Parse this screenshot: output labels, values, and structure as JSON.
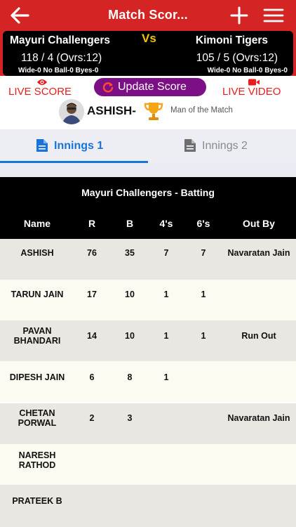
{
  "header": {
    "title": "Match Scor...",
    "back_icon": "back-arrow-icon",
    "add_icon": "plus-icon",
    "menu_icon": "hamburger-menu-icon",
    "bar_color": "#d42424"
  },
  "scoreboard": {
    "team_a": {
      "name": "Mayuri Challengers",
      "score": "118 / 4 (Ovrs:12)",
      "extras": "Wide-0 No Ball-0 Byes-0"
    },
    "vs_label": "Vs",
    "team_b": {
      "name": "Kimoni Tigers",
      "score": "105 / 5 (Ovrs:12)",
      "extras": "Wide-0 No Ball-0 Byes-0"
    },
    "vs_color": "#f5c400"
  },
  "actions": {
    "live_score_label": "LIVE SCORE",
    "update_score_label": "Update Score",
    "live_video_label": "LIVE VIDEO",
    "accent_color": "#ea1c1c",
    "button_color": "#7d0f86"
  },
  "man_of_match": {
    "name": "ASHISH-",
    "label": "Man of the Match",
    "trophy_icon": "trophy-icon"
  },
  "tabs": [
    {
      "label": "Innings 1",
      "active": true
    },
    {
      "label": "Innings 2",
      "active": false
    }
  ],
  "table": {
    "title": "Mayuri Challengers - Batting",
    "columns": [
      "Name",
      "R",
      "B",
      "4's",
      "6's",
      "Out By"
    ],
    "rows": [
      {
        "name": "ASHISH",
        "r": "76",
        "b": "35",
        "fours": "7",
        "sixes": "7",
        "out_by": "Navaratan Jain"
      },
      {
        "name": "TARUN JAIN",
        "r": "17",
        "b": "10",
        "fours": "1",
        "sixes": "1",
        "out_by": ""
      },
      {
        "name": "PAVAN BHANDARI",
        "name_line1": "PAVAN",
        "name_line2": "BHANDARI",
        "r": "14",
        "b": "10",
        "fours": "1",
        "sixes": "1",
        "out_by": "Run Out"
      },
      {
        "name": "DIPESH JAIN",
        "r": "6",
        "b": "8",
        "fours": "1",
        "sixes": "",
        "out_by": ""
      },
      {
        "name": "CHETAN PORWAL",
        "name_line1": "CHETAN",
        "name_line2": "PORWAL",
        "r": "2",
        "b": "3",
        "fours": "",
        "sixes": "",
        "out_by": "Navaratan Jain"
      },
      {
        "name": "NARESH RATHOD",
        "name_line1": "NARESH",
        "name_line2": "RATHOD",
        "r": "",
        "b": "",
        "fours": "",
        "sixes": "",
        "out_by": ""
      },
      {
        "name": "PRATEEK B",
        "r": "",
        "b": "",
        "fours": "",
        "sixes": "",
        "out_by": ""
      }
    ]
  }
}
